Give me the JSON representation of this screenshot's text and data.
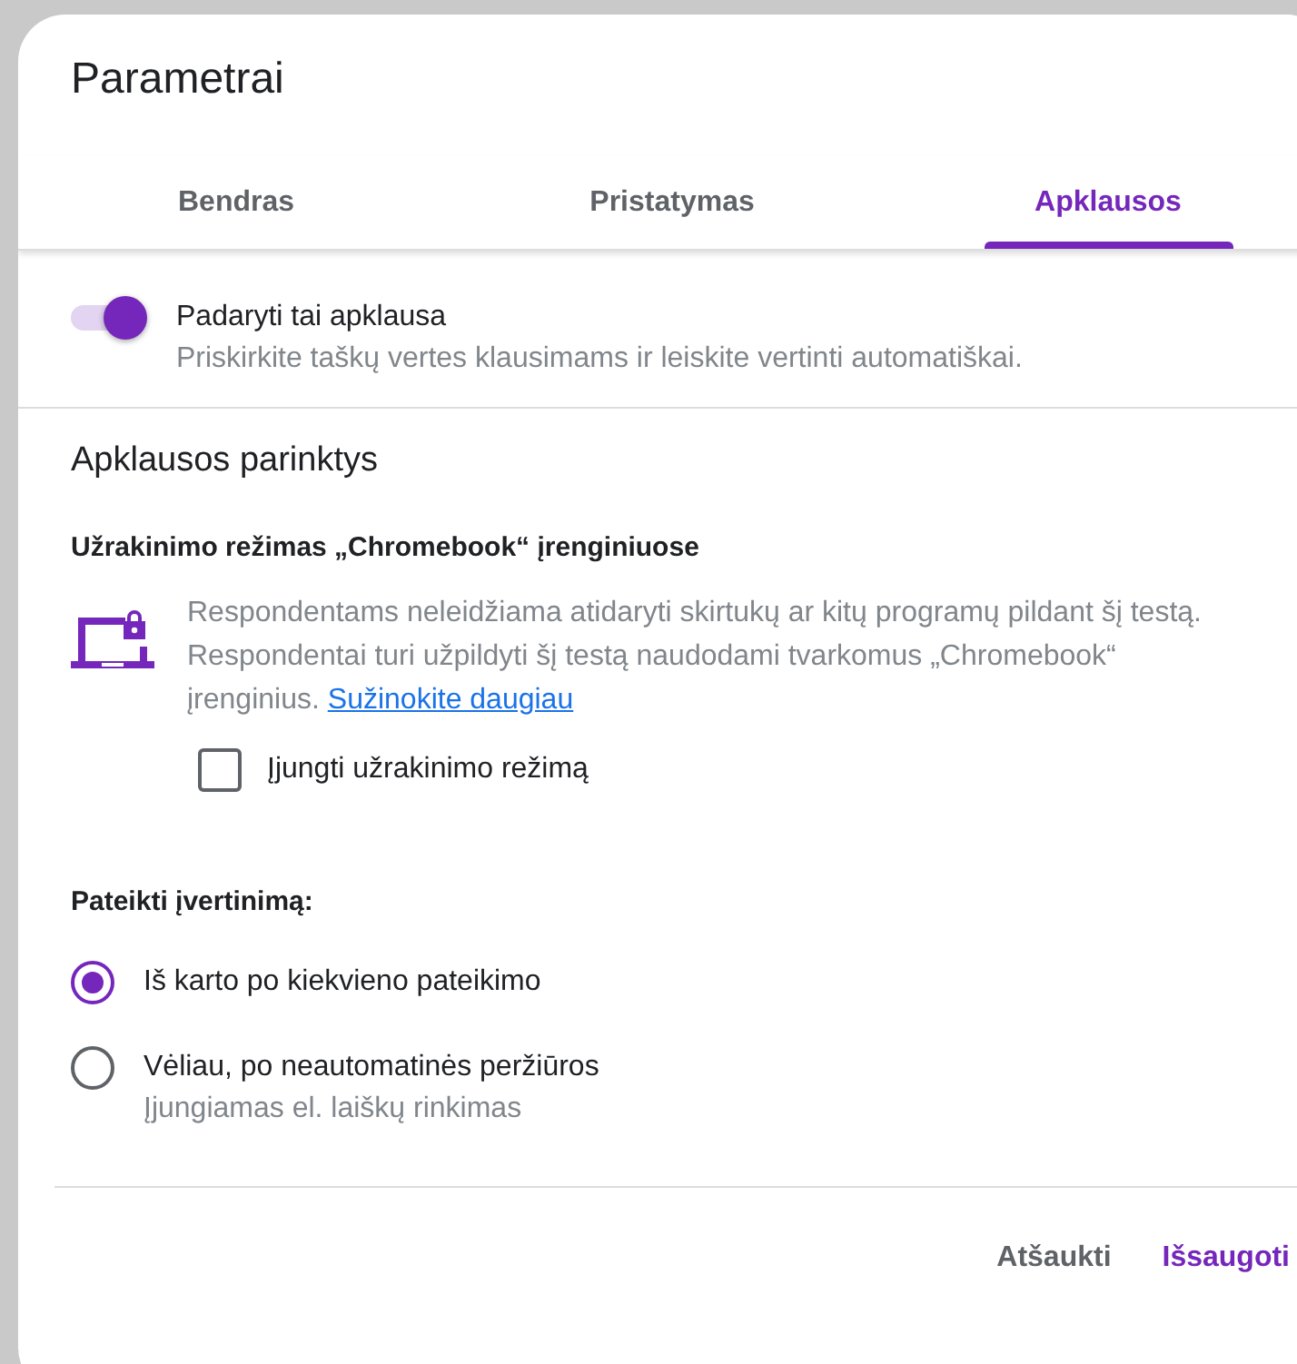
{
  "dialog": {
    "title": "Parametrai"
  },
  "tabs": [
    {
      "label": "Bendras",
      "selected": false
    },
    {
      "label": "Pristatymas",
      "selected": false
    },
    {
      "label": "Apklausos",
      "selected": true
    }
  ],
  "quiz_toggle": {
    "label": "Padaryti tai apklausa",
    "description": "Priskirkite taškų vertes klausimams ir leiskite vertinti automatiškai.",
    "on": true
  },
  "section_title": "Apklausos parinktys",
  "lock_mode": {
    "heading": "Užrakinimo režimas „Chromebook“ įrenginiuose",
    "description": "Respondentams neleidžiama atidaryti skirtukų ar kitų programų pildant šį testą. Respondentai turi užpildyti šį testą naudodami tvarkomus „Chromebook“ įrenginius.",
    "link": "Sužinokite daugiau",
    "checkbox": {
      "label": "Įjungti užrakinimo režimą",
      "checked": false
    }
  },
  "release_grade": {
    "heading": "Pateikti įvertinimą:",
    "options": [
      {
        "label": "Iš karto po kiekvieno pateikimo",
        "selected": true
      },
      {
        "label": "Vėliau, po neautomatinės peržiūros",
        "hint": "Įjungiamas el. laiškų rinkimas",
        "selected": false
      }
    ]
  },
  "buttons": [
    {
      "label": "Atšaukti",
      "kind": "secondary"
    },
    {
      "label": "Išsaugoti",
      "kind": "primary"
    }
  ]
}
